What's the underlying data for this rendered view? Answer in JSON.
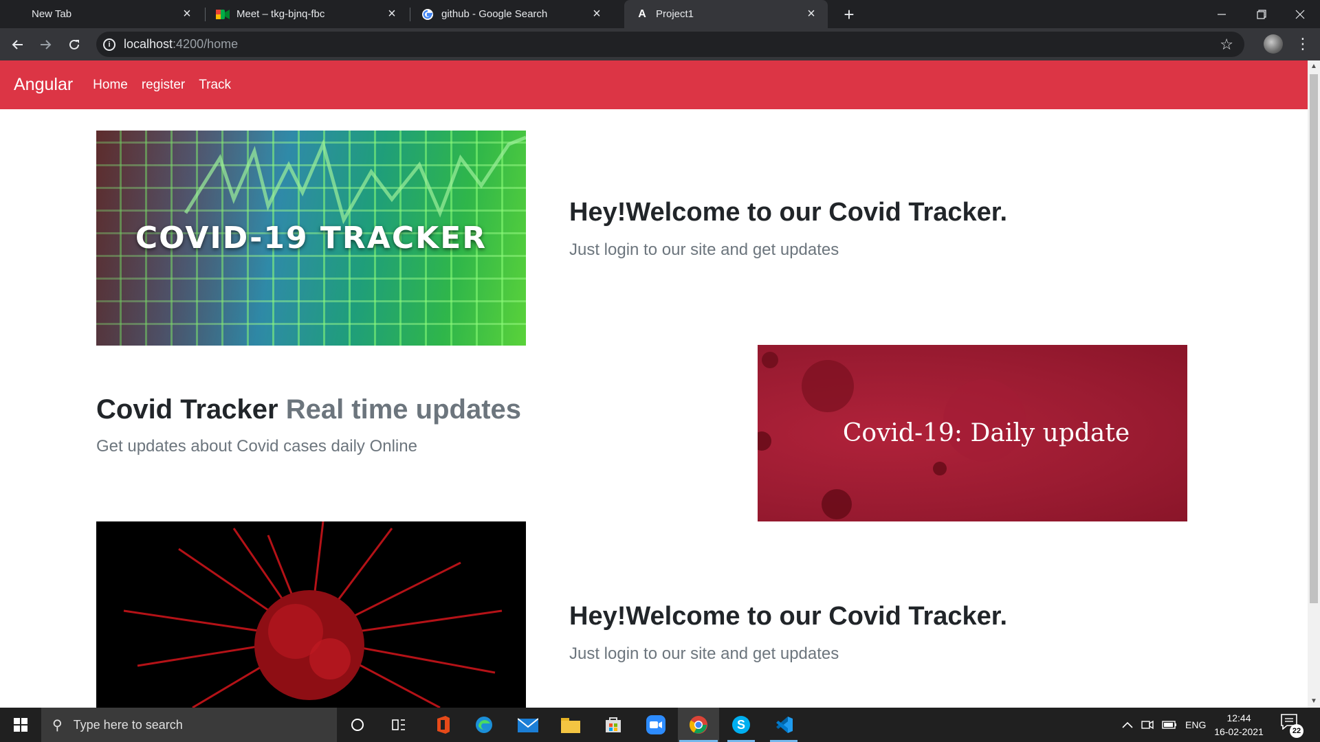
{
  "browser": {
    "tabs": [
      {
        "title": "New Tab",
        "icon": "none"
      },
      {
        "title": "Meet – tkg-bjnq-fbc",
        "icon": "google-meet-icon"
      },
      {
        "title": "github - Google Search",
        "icon": "google-icon"
      },
      {
        "title": "Project1",
        "icon": "angular-icon",
        "active": true
      }
    ],
    "url_host": "localhost",
    "url_path": ":4200/home"
  },
  "navbar": {
    "brand": "Angular",
    "links": [
      "Home",
      "register",
      "Track"
    ],
    "color": "#dc3545"
  },
  "sections": [
    {
      "image_text": "COVID-19 TRACKER",
      "heading": "Hey!Welcome to our Covid Tracker.",
      "lead": "Just login to our site and get updates"
    },
    {
      "heading_main": "Covid Tracker",
      "heading_muted": "Real time updates",
      "lead": "Get updates about Covid cases daily Online",
      "image_text": "Covid-19: Daily update"
    },
    {
      "heading": "Hey!Welcome to our Covid Tracker.",
      "lead": "Just login to our site and get updates"
    }
  ],
  "taskbar": {
    "search_placeholder": "Type here to search",
    "apps": [
      "cortana-icon",
      "task-view-icon",
      "office-icon",
      "edge-icon",
      "mail-icon",
      "file-explorer-icon",
      "store-icon",
      "zoom-icon",
      "chrome-icon",
      "skype-icon",
      "vscode-icon"
    ],
    "language": "ENG",
    "time": "12:44",
    "date": "16-02-2021",
    "notification_count": "22"
  }
}
